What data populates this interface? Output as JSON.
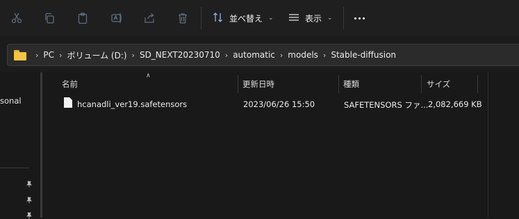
{
  "toolbar": {
    "icons": [
      "cut-icon",
      "copy-icon",
      "paste-icon",
      "rename-icon",
      "share-icon",
      "delete-icon"
    ],
    "sort_label": "並べ替え",
    "view_label": "表示",
    "more_label": "..."
  },
  "address": {
    "breadcrumbs": [
      "PC",
      "ボリューム (D:)",
      "SD_NEXT20230710",
      "automatic",
      "models",
      "Stable-diffusion"
    ]
  },
  "nav": {
    "partial_label": "sonal"
  },
  "columns": {
    "name": "名前",
    "modified": "更新日時",
    "type": "種類",
    "size": "サイズ"
  },
  "files": [
    {
      "name": "hcanadli_ver19.safetensors",
      "modified": "2023/06/26 15:50",
      "type": "SAFETENSORS ファ...",
      "size": "2,082,669 KB"
    }
  ],
  "colors": {
    "background": "#191919",
    "toolbar": "#1f1f1f",
    "folder": "#f2c443"
  }
}
